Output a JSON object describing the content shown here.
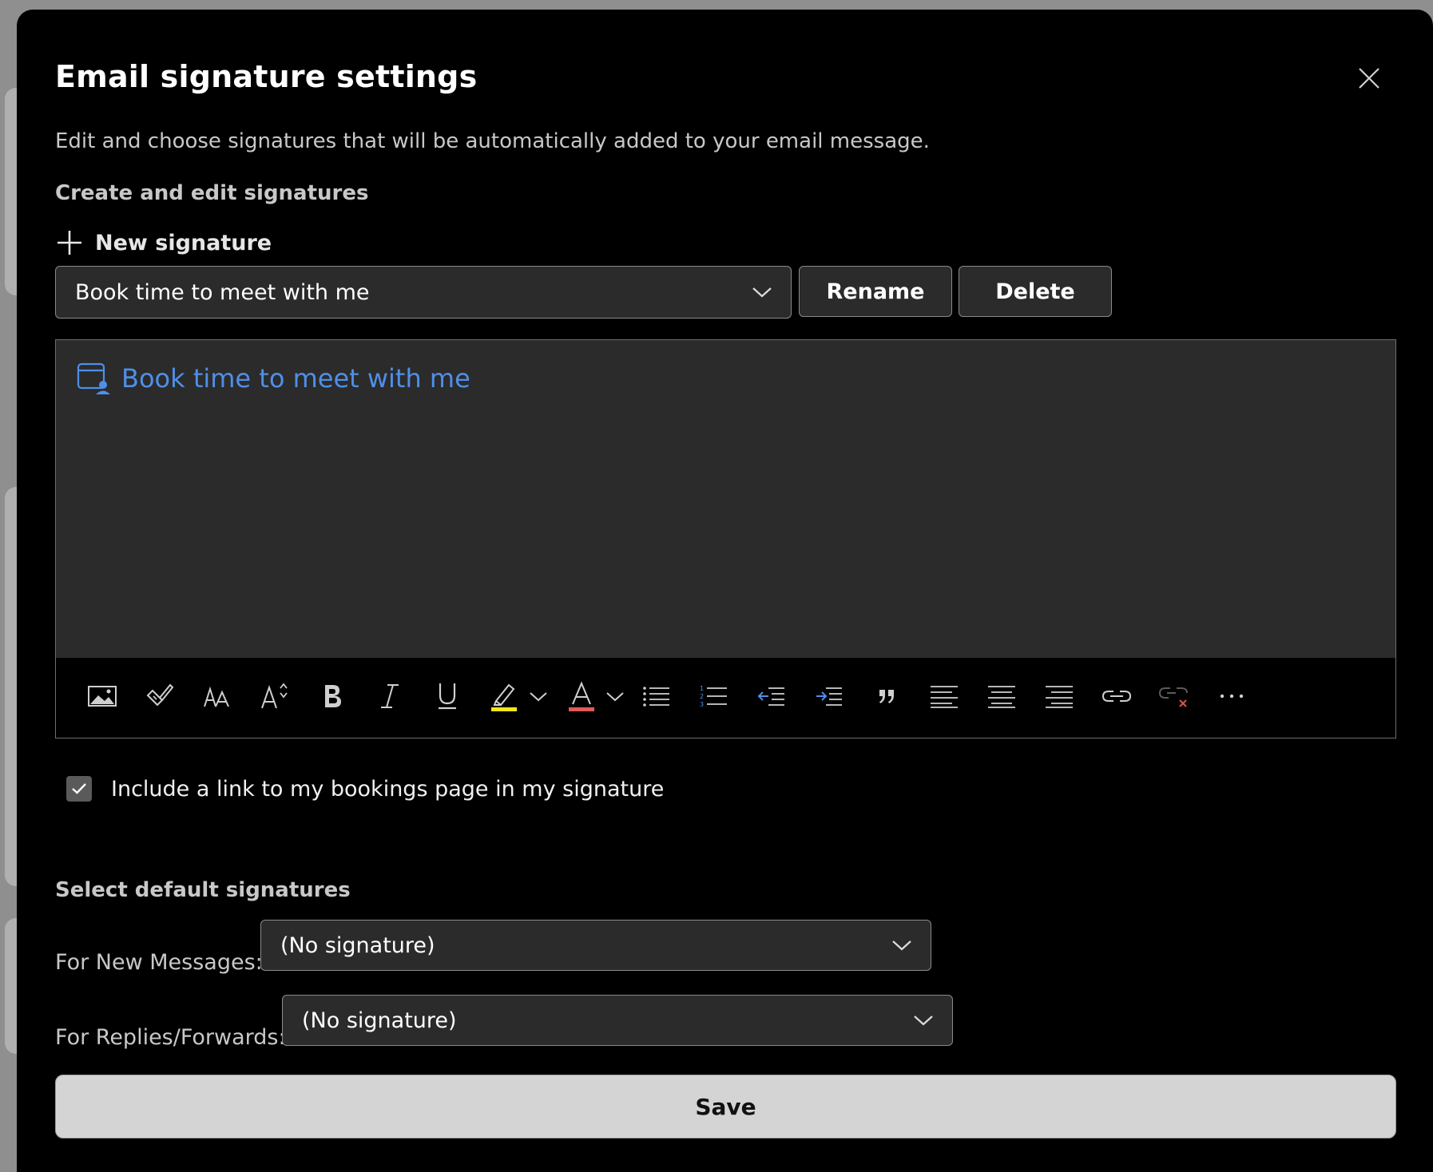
{
  "dialog": {
    "title": "Email signature settings",
    "subtitle": "Edit and choose signatures that will be automatically added to your email message."
  },
  "create_section": {
    "heading": "Create and edit signatures",
    "new_signature_label": "New signature",
    "selected_signature": "Book time to meet with me",
    "rename_label": "Rename",
    "delete_label": "Delete"
  },
  "editor": {
    "link_text": "Book time to meet with me",
    "link_color": "#4f8fe8",
    "toolbar_icons": [
      "insert-picture-icon",
      "format-painter-icon",
      "font-icon",
      "font-size-icon",
      "bold-icon",
      "italic-icon",
      "underline-icon",
      "highlight-icon",
      "font-color-icon",
      "bullets-icon",
      "numbering-icon",
      "decrease-indent-icon",
      "increase-indent-icon",
      "quote-icon",
      "align-left-icon",
      "align-center-icon",
      "align-right-icon",
      "insert-link-icon",
      "remove-link-icon",
      "more-options-icon"
    ],
    "highlight_color": "#f5e61a",
    "font_color": "#e05a5a"
  },
  "bookings_checkbox": {
    "label": "Include a link to my bookings page in my signature",
    "checked": true
  },
  "defaults_section": {
    "heading": "Select default signatures",
    "new_messages_label": "For New Messages:",
    "new_messages_value": "(No signature)",
    "replies_label": "For Replies/Forwards:",
    "replies_value": "(No signature)"
  },
  "save_label": "Save"
}
